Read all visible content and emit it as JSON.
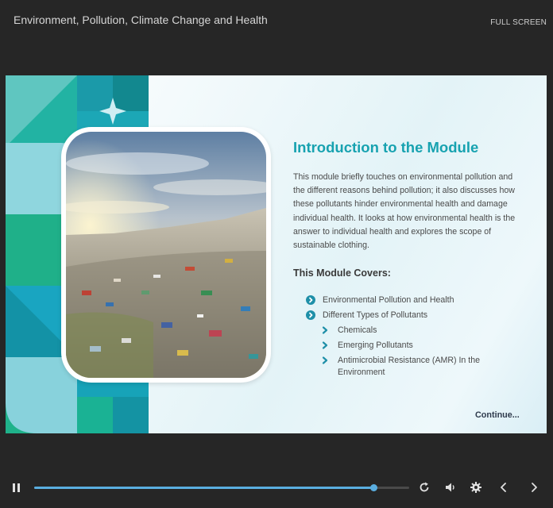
{
  "header": {
    "course_title": "Environment, Pollution, Climate Change and Health",
    "fullscreen_label": "FULL SCREEN"
  },
  "slide": {
    "heading": "Introduction to the Module",
    "paragraph": "This module briefly touches on environmental pollution and the different reasons behind pollution; it also discusses how these pollutants hinder environmental health and damage individual health. It looks at how environmental health is the answer to individual health and explores the scope of sustainable clothing.",
    "covers_heading": "This Module Covers:",
    "topics": [
      {
        "label": "Environmental Pollution and Health",
        "level": 1
      },
      {
        "label": "Different Types of Pollutants",
        "level": 1
      },
      {
        "label": "Chemicals",
        "level": 2
      },
      {
        "label": "Emerging Pollutants",
        "level": 2
      },
      {
        "label": "Antimicrobial Resistance (AMR) In the Environment",
        "level": 2
      }
    ],
    "continue_label": "Continue...",
    "image": "plastic-bottle-landfill-photo"
  },
  "player": {
    "progress": 0.905,
    "icons": [
      "pause-icon",
      "replay-icon",
      "volume-icon",
      "settings-icon",
      "previous-icon",
      "next-icon"
    ]
  },
  "colors": {
    "background": "#262626",
    "accent": "#17a2b0",
    "progress": "#5aaee0",
    "bullet": "#1e8fa8"
  }
}
